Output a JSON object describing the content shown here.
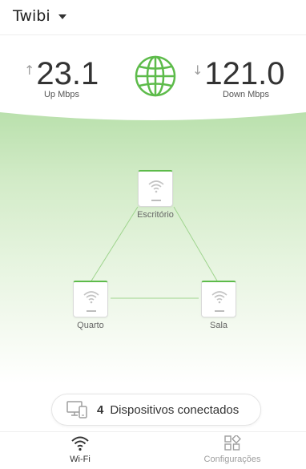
{
  "header": {
    "network_name": "Twibi"
  },
  "speed": {
    "up": {
      "arrow": "↑",
      "value": "23.1",
      "label": "Up Mbps"
    },
    "down": {
      "arrow": "↓",
      "value": "121.0",
      "label": "Down Mbps"
    }
  },
  "mesh": {
    "nodes": [
      {
        "label": "Escritório"
      },
      {
        "label": "Quarto"
      },
      {
        "label": "Sala"
      }
    ]
  },
  "devices": {
    "count": "4",
    "label": "Dispositivos conectados"
  },
  "bottom_nav": {
    "wifi_label": "Wi-Fi",
    "settings_label": "Configurações"
  },
  "colors": {
    "accent": "#5dbb4a",
    "map_top": "#b9e0ac"
  }
}
